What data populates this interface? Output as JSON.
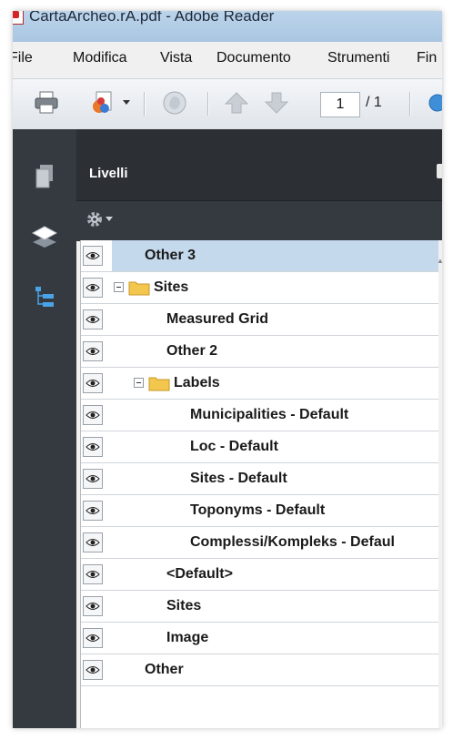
{
  "window": {
    "title": "CartaArcheo.rA.pdf - Adobe Reader"
  },
  "menu": [
    "File",
    "Modifica",
    "Vista",
    "Documento",
    "Strumenti",
    "Fin"
  ],
  "toolbar": {
    "icons": [
      "print-icon",
      "share-icon",
      "dropdown-arrow-icon",
      "hand-icon",
      "arrow-up-icon",
      "arrow-down-icon",
      "zoom-icon"
    ],
    "page_current": "1",
    "page_total": "/ 1"
  },
  "panel": {
    "title": "Livelli",
    "options_icon": "gear-icon"
  },
  "layers": [
    {
      "label": "Other 3",
      "level": 0,
      "selected": true
    },
    {
      "label": "Sites",
      "level": 0,
      "group": true
    },
    {
      "label": "Measured Grid",
      "level": 1
    },
    {
      "label": "Other 2",
      "level": 1
    },
    {
      "label": "Labels",
      "level": 1,
      "group": true
    },
    {
      "label": "Municipalities - Default",
      "level": 2
    },
    {
      "label": "Loc - Default",
      "level": 2
    },
    {
      "label": "Sites - Default",
      "level": 2
    },
    {
      "label": "Toponyms - Default",
      "level": 2
    },
    {
      "label": "Complessi/Kompleks - Defaul",
      "level": 2
    },
    {
      "label": "<Default>",
      "level": 1
    },
    {
      "label": "Sites",
      "level": 1
    },
    {
      "label": "Image",
      "level": 1
    },
    {
      "label": "Other",
      "level": 0
    }
  ],
  "colors": {
    "nav_dark": "#353a40",
    "selection": "#c5d9ec",
    "folder": "#f3c64d"
  }
}
